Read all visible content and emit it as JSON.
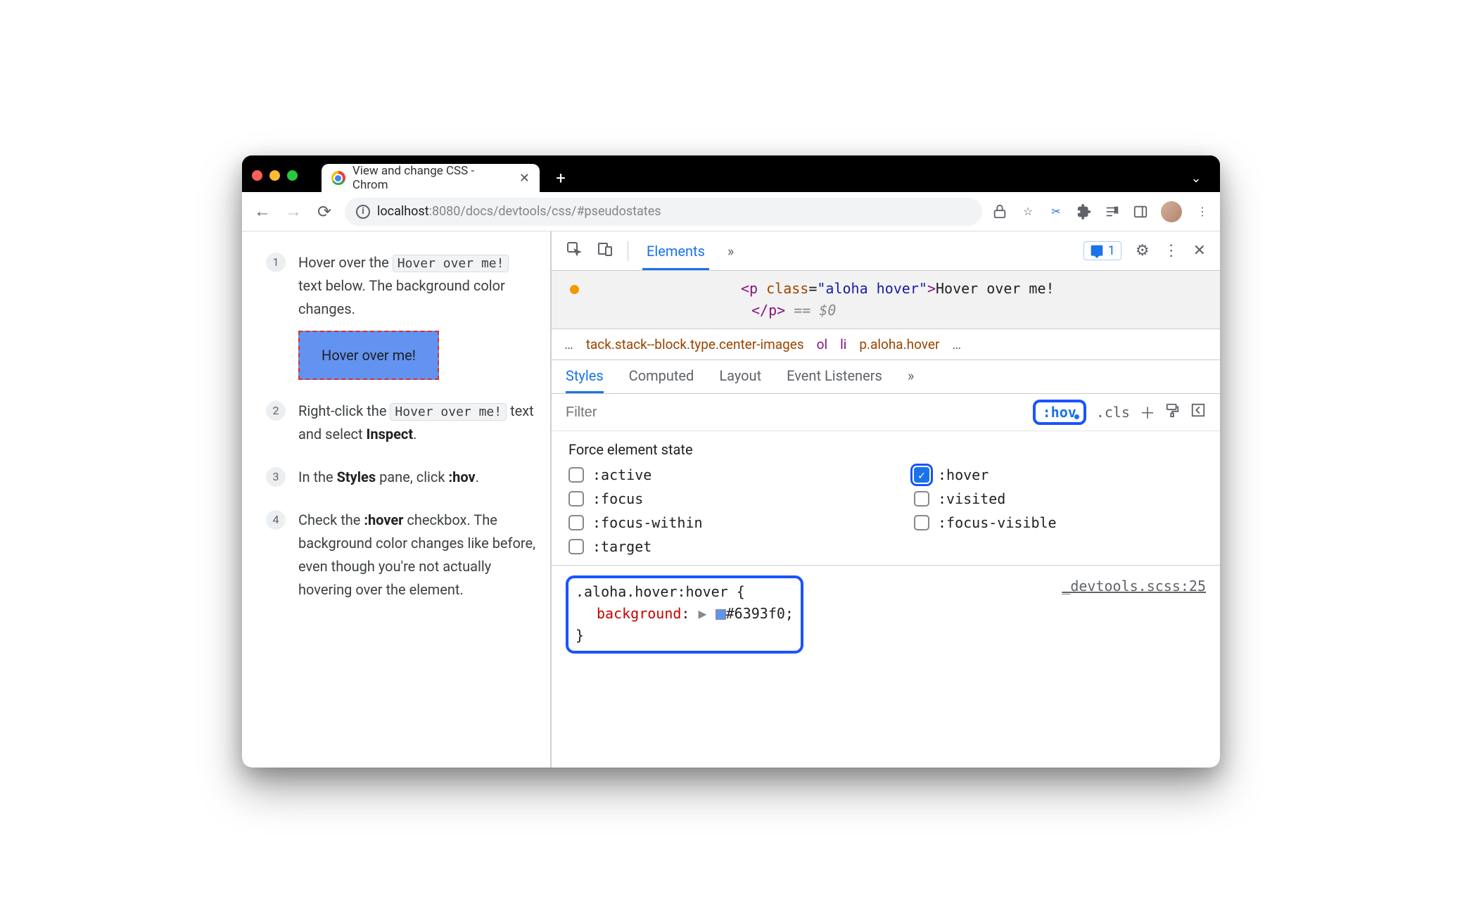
{
  "window": {
    "tab_title": "View and change CSS - Chrom",
    "url_host": "localhost",
    "url_port": ":8080",
    "url_path": "/docs/devtools/css/#pseudostates"
  },
  "page": {
    "steps": [
      {
        "num": "1",
        "pre": "Hover over the ",
        "code": "Hover over me!",
        "post": " text below. The background color changes."
      },
      {
        "num": "2",
        "pre": "Right-click the ",
        "code": "Hover over me!",
        "post": " text and select ",
        "bold": "Inspect",
        "post2": "."
      },
      {
        "num": "3",
        "pre": "In the ",
        "bold": "Styles",
        "mid": " pane, click ",
        "bold2": ":hov",
        "post": "."
      },
      {
        "num": "4",
        "pre": "Check the ",
        "bold": ":hover",
        "post": " checkbox. The background color changes like before, even though you're not actually hovering over the element."
      }
    ],
    "hover_button": "Hover over me!"
  },
  "devtools": {
    "top_tab": "Elements",
    "issues_count": "1",
    "dom": {
      "tag_open_p": "<p ",
      "attr_class": "class",
      "attr_eq": "=",
      "attr_val": "\"aloha hover\"",
      "gt": ">",
      "text": "Hover over me!",
      "close": "</p>",
      "eq0": " == $0"
    },
    "crumbs": {
      "dots_l": "…",
      "c1": "tack.stack--block.type.center-images",
      "c2": "ol",
      "c3": "li",
      "c4": "p.aloha.hover",
      "dots_r": "…"
    },
    "styles_tabs": [
      "Styles",
      "Computed",
      "Layout",
      "Event Listeners"
    ],
    "filter_placeholder": "Filter",
    "hov_label": ":hov",
    "cls_label": ".cls",
    "force_title": "Force element state",
    "states": {
      "active": ":active",
      "hover": ":hover",
      "focus": ":focus",
      "visited": ":visited",
      "focus_within": ":focus-within",
      "focus_visible": ":focus-visible",
      "target": ":target"
    },
    "rule": {
      "selector": ".aloha.hover:hover {",
      "prop": "background",
      "colon": ":",
      "arrow": "▶",
      "value": "#6393f0;",
      "close": "}",
      "source": "_devtools.scss:25"
    }
  }
}
